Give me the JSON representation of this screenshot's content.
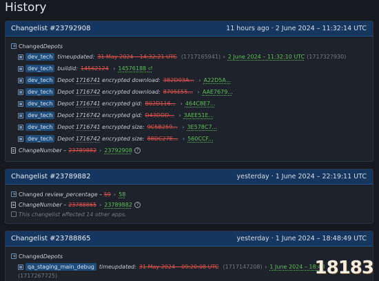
{
  "page_title": "History",
  "cards": [
    {
      "title": "Changelist #23792908",
      "time": "11 hours ago · 2 June 2024 – 11:32:14 UTC",
      "section_label": "Changed ",
      "section_label_em": "Depots",
      "rows": [
        {
          "tag": "dev_tech",
          "key": "timeupdated:",
          "old": "31 May 2024 – 14:32:21 UTC",
          "old_extra": "(1717165941)",
          "new": "2 June 2024 – 11:32:10 UTC",
          "new_extra": "(1717327930)"
        },
        {
          "tag": "dev_tech",
          "key": "buildid:",
          "old": "14562124",
          "old_extra": "",
          "new": "14576188 ⏎",
          "new_extra": ""
        },
        {
          "tag": "dev_tech",
          "key_pre": "Depot ",
          "key_id": "1716741",
          "key": " encrypted download:",
          "old": "3B2D03A...",
          "old_extra": "",
          "new": "A22D5A...",
          "new_extra": ""
        },
        {
          "tag": "dev_tech",
          "key_pre": "Depot ",
          "key_id": "1716742",
          "key": " encrypted download:",
          "old": "8705E55...",
          "old_extra": "",
          "new": "AAE7679...",
          "new_extra": ""
        },
        {
          "tag": "dev_tech",
          "key_pre": "Depot ",
          "key_id": "1716741",
          "key": " encrypted gid:",
          "old": "B02D116...",
          "old_extra": "",
          "new": "464C8E7...",
          "new_extra": ""
        },
        {
          "tag": "dev_tech",
          "key_pre": "Depot ",
          "key_id": "1716742",
          "key": " encrypted gid:",
          "old": "D43DDD...",
          "old_extra": "",
          "new": "3AEE51E...",
          "new_extra": ""
        },
        {
          "tag": "dev_tech",
          "key_pre": "Depot ",
          "key_id": "1716741",
          "key": " encrypted size:",
          "old": "9C5B259...",
          "old_extra": "",
          "new": "3E578C7...",
          "new_extra": ""
        },
        {
          "tag": "dev_tech",
          "key_pre": "Depot ",
          "key_id": "1716742",
          "key": " encrypted size:",
          "old": "88DC27E...",
          "old_extra": "",
          "new": "560CCF...",
          "new_extra": ""
        }
      ],
      "change_number_label": "ChangeNumber –",
      "change_old": "23789882",
      "change_new": "23792908"
    },
    {
      "title": "Changelist #23789882",
      "time": "yesterday · 1 June 2024 – 22:19:11 UTC",
      "changed_label": "Changed",
      "changed_key": "review_percentage",
      "changed_old": "59",
      "changed_new": "58",
      "change_number_label": "ChangeNumber –",
      "change_old": "23788865",
      "change_new": "23789882",
      "affected_text": "This changelist affected 14 other apps."
    },
    {
      "title": "Changelist #23788865",
      "time": "yesterday · 1 June 2024 – 18:48:49 UTC",
      "section_label": "Changed ",
      "section_label_em": "Depots",
      "row": {
        "tag": "qa_staging_main_debug",
        "key": "timeupdated:",
        "old": "31 May 2024 – 09:20:08 UTC",
        "old_extra": "(1717147208)",
        "new": "1 June 2024 – 18:48",
        "new_extra": "(1717267725)"
      }
    }
  ],
  "watermark": "18183",
  "colors": {
    "header_bg": "#15365e",
    "old_value": "#e0524e",
    "new_value": "#5fbf5a",
    "tag_bg": "#1f4c78"
  }
}
